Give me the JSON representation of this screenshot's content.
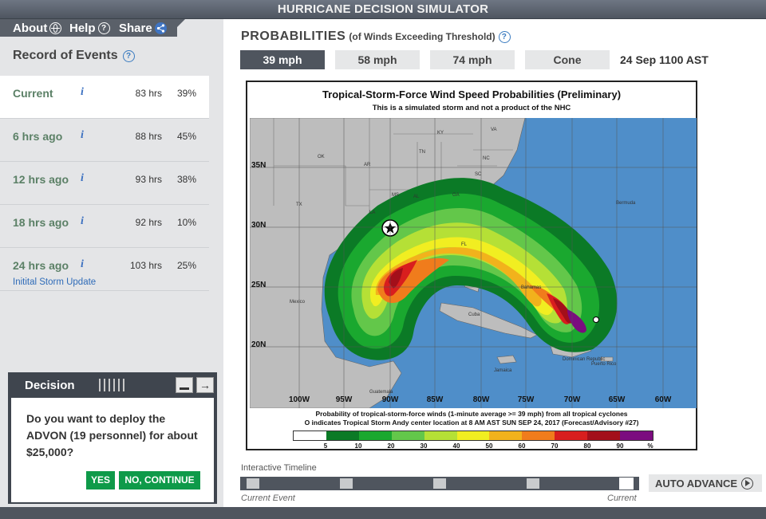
{
  "app": {
    "title": "HURRICANE DECISION SIMULATOR"
  },
  "nav": {
    "about": "About",
    "help": "Help",
    "share": "Share"
  },
  "record": {
    "title": "Record of Events",
    "info_glyph": "i",
    "events": [
      {
        "label": "Current",
        "hrs": "83 hrs",
        "pct": "39%"
      },
      {
        "label": "6 hrs ago",
        "hrs": "88 hrs",
        "pct": "45%"
      },
      {
        "label": "12 hrs ago",
        "hrs": "93 hrs",
        "pct": "38%"
      },
      {
        "label": "18 hrs ago",
        "hrs": "92 hrs",
        "pct": "10%"
      },
      {
        "label": "24 hrs ago",
        "hrs": "103 hrs",
        "pct": "25%",
        "sub": "Initital Storm Update"
      }
    ]
  },
  "decision": {
    "title": "Decision",
    "question": "Do you want to deploy the ADVON (19 personnel) for about $25,000?",
    "yes_label": "YES",
    "no_label": "NO, CONTINUE"
  },
  "probabilities": {
    "title": "PROBABILITIES",
    "subtitle": "(of Winds Exceeding Threshold)",
    "tabs": [
      "39 mph",
      "58 mph",
      "74 mph",
      "Cone"
    ],
    "active_tab": "39 mph",
    "datetime": "24 Sep 1100 AST"
  },
  "map": {
    "title": "Tropical-Storm-Force Wind Speed Probabilities (Preliminary)",
    "subtitle": "This is a simulated storm and not a product of the NHC",
    "lat_labels": [
      "35N",
      "30N",
      "25N",
      "20N"
    ],
    "lon_labels": [
      "100W",
      "95W",
      "90W",
      "85W",
      "80W",
      "75W",
      "70W",
      "65W",
      "60W"
    ],
    "place_labels": [
      "KY",
      "VA",
      "TN",
      "NC",
      "OK",
      "AR",
      "SC",
      "MS",
      "AL",
      "GA",
      "TX",
      "LA",
      "FL",
      "Bermuda",
      "Mexico",
      "Bahamas",
      "Cuba",
      "Jamaica",
      "Dominican Republic",
      "Puerto Rico",
      "Guatemala"
    ],
    "legend_line1": "Probability of tropical-storm-force winds (1-minute average >= 39 mph) from all tropical cyclones",
    "legend_line2": "O indicates Tropical Storm Andy center location at 8 AM AST SUN SEP 24, 2017 (Forecast/Advisory #27)",
    "legend_labels": [
      "5",
      "10",
      "20",
      "30",
      "40",
      "50",
      "60",
      "70",
      "80",
      "90",
      "%"
    ],
    "legend_colors": [
      "#ffffff",
      "#0b7a26",
      "#1aa82f",
      "#63c74a",
      "#b5e036",
      "#f1ee21",
      "#f2b21c",
      "#f07c1c",
      "#d81e1e",
      "#a30f1a",
      "#7b0c7f"
    ]
  },
  "timeline": {
    "label": "Interactive Timeline",
    "left_label": "Current Event",
    "right_label": "Current",
    "auto_label": "AUTO ADVANCE"
  }
}
